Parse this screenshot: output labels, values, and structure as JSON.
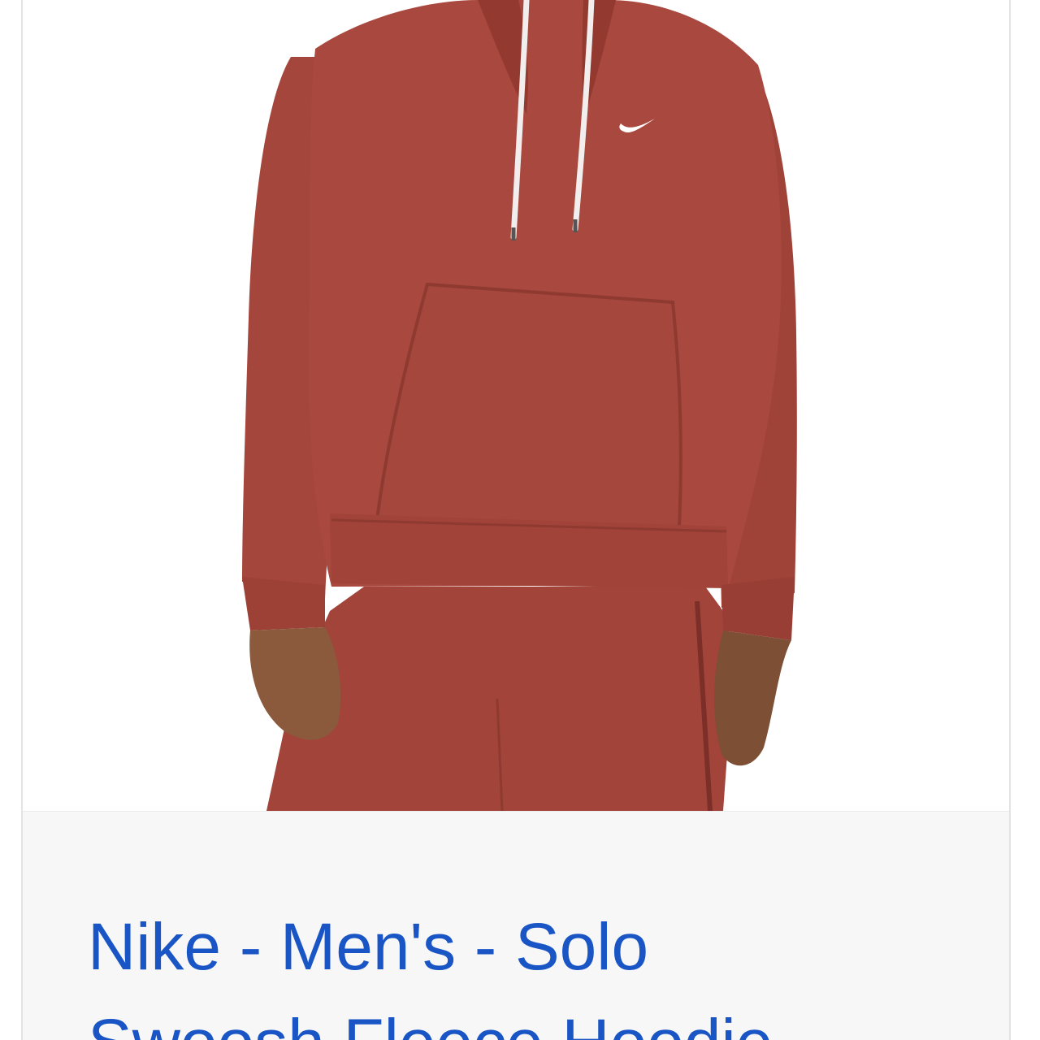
{
  "product": {
    "image_alt": "Nike - Men's - Solo Swoosh Fleece Hoodie",
    "title": "Nike - Men's - Solo Swoosh Fleece Hoodie"
  },
  "colors": {
    "garment": "#a8493f",
    "link": "#1a55c6",
    "caption_background": "#f7f7f7"
  }
}
